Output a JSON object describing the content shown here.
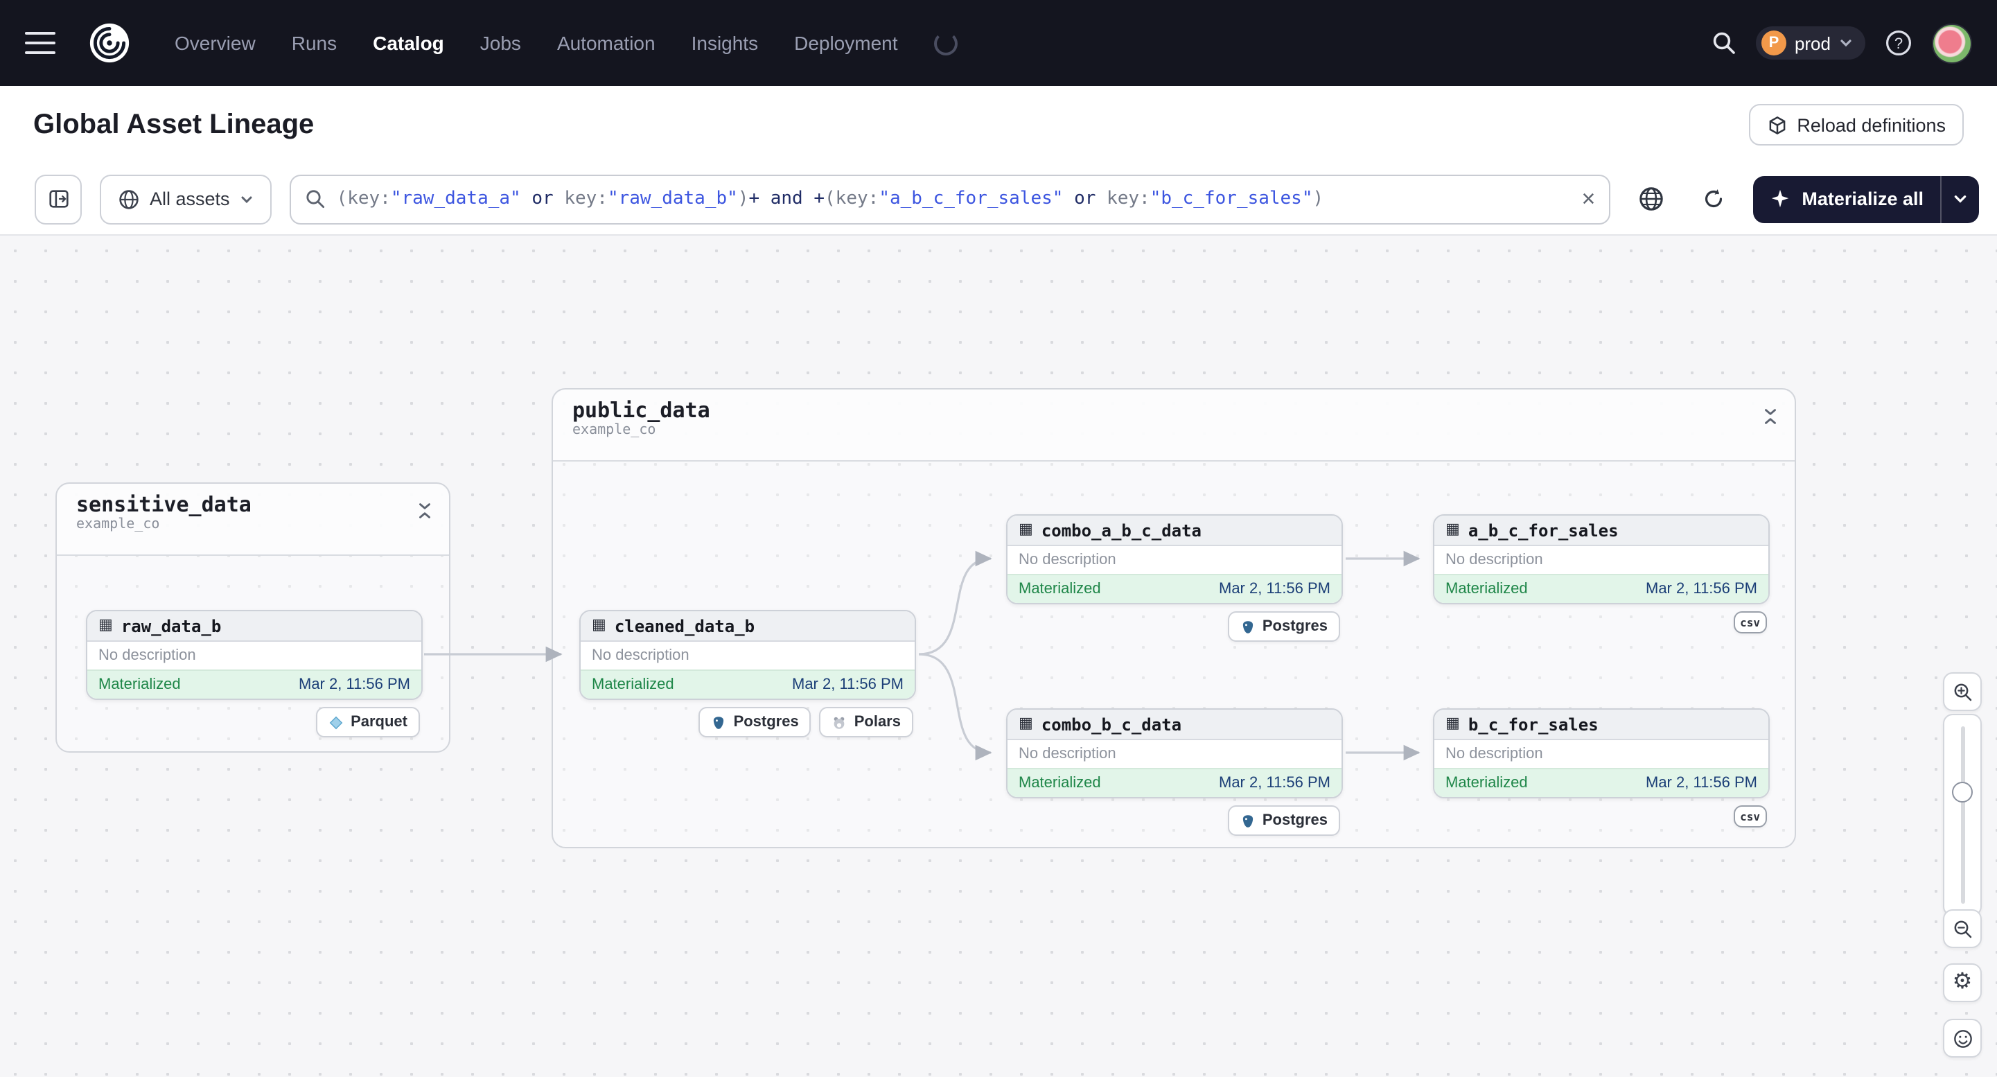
{
  "navbar": {
    "items": [
      {
        "label": "Overview"
      },
      {
        "label": "Runs"
      },
      {
        "label": "Catalog"
      },
      {
        "label": "Jobs"
      },
      {
        "label": "Automation"
      },
      {
        "label": "Insights"
      },
      {
        "label": "Deployment"
      }
    ],
    "deployment_switcher": {
      "initial": "P",
      "name": "prod"
    }
  },
  "header": {
    "title": "Global Asset Lineage",
    "reload_button": "Reload definitions"
  },
  "toolbar": {
    "scope_label": "All assets",
    "materialize_label": "Materialize all",
    "clear_label": "×",
    "query_tokens": [
      {
        "text": "(key:",
        "type": "key"
      },
      {
        "text": "\"raw_data_a\"",
        "type": "string"
      },
      {
        "text": " or ",
        "type": "op"
      },
      {
        "text": "key:",
        "type": "key"
      },
      {
        "text": "\"raw_data_b\"",
        "type": "string"
      },
      {
        "text": ")",
        "type": "key"
      },
      {
        "text": "+",
        "type": "plus"
      },
      {
        "text": " and ",
        "type": "op"
      },
      {
        "text": "+",
        "type": "plus"
      },
      {
        "text": "(key:",
        "type": "key"
      },
      {
        "text": "\"a_b_c_for_sales\"",
        "type": "string"
      },
      {
        "text": " or ",
        "type": "op"
      },
      {
        "text": "key:",
        "type": "key"
      },
      {
        "text": "\"b_c_for_sales\"",
        "type": "string"
      },
      {
        "text": ")",
        "type": "key"
      }
    ]
  },
  "graph": {
    "groups": [
      {
        "name": "sensitive_data",
        "location": "example_co"
      },
      {
        "name": "public_data",
        "location": "example_co"
      }
    ],
    "nodes": [
      {
        "name": "raw_data_b",
        "description": "No description",
        "status": "Materialized",
        "timestamp": "Mar 2, 11:56 PM",
        "tags": [
          "Parquet"
        ]
      },
      {
        "name": "cleaned_data_b",
        "description": "No description",
        "status": "Materialized",
        "timestamp": "Mar 2, 11:56 PM",
        "tags": [
          "Postgres",
          "Polars"
        ]
      },
      {
        "name": "combo_a_b_c_data",
        "description": "No description",
        "status": "Materialized",
        "timestamp": "Mar 2, 11:56 PM",
        "tags": [
          "Postgres"
        ]
      },
      {
        "name": "a_b_c_for_sales",
        "description": "No description",
        "status": "Materialized",
        "timestamp": "Mar 2, 11:56 PM",
        "tags": [
          "csv"
        ]
      },
      {
        "name": "combo_b_c_data",
        "description": "No description",
        "status": "Materialized",
        "timestamp": "Mar 2, 11:56 PM",
        "tags": [
          "Postgres"
        ]
      },
      {
        "name": "b_c_for_sales",
        "description": "No description",
        "status": "Materialized",
        "timestamp": "Mar 2, 11:56 PM",
        "tags": [
          "csv"
        ]
      }
    ]
  },
  "colors": {
    "navbar_bg": "#14151f",
    "materialized_bg": "#e2f5e9",
    "materialized_text": "#1e8648",
    "timestamp_text": "#1b3e77",
    "accent_dark": "#181a33",
    "query_string": "#3c55e0"
  }
}
